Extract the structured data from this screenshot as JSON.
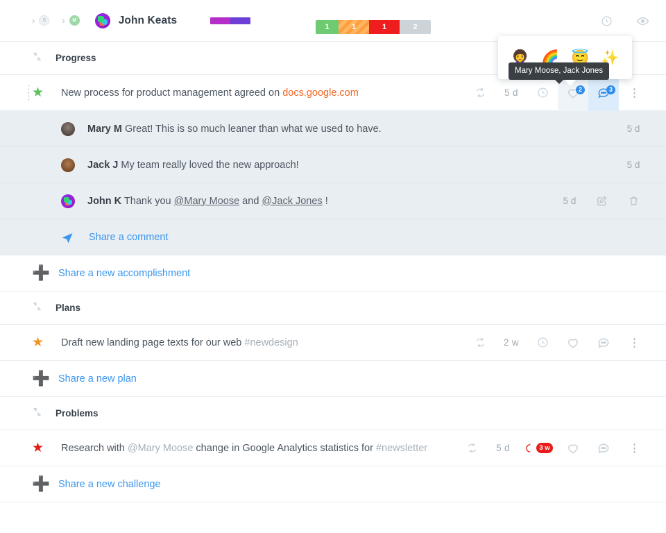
{
  "header": {
    "breadcrumbs": [
      {
        "sep": "›",
        "label": "S",
        "name": "breadcrumb-company"
      },
      {
        "sep": "›",
        "label": "M",
        "name": "breadcrumb-team"
      }
    ],
    "user_name": "John Keats",
    "avatar_name": "john-keats-avatar",
    "progress_chip_colors": [
      "#b42fc9",
      "#6d3fd4"
    ],
    "status_segments": [
      {
        "value": "1",
        "kind": "green"
      },
      {
        "value": "1",
        "kind": "orange"
      },
      {
        "value": "1",
        "kind": "red"
      },
      {
        "value": "2",
        "kind": "gray"
      }
    ],
    "icons": [
      {
        "name": "history-clock-icon"
      },
      {
        "name": "eye-visibility-icon"
      }
    ]
  },
  "popover": {
    "emojis": [
      "👩‍🦱",
      "🌈",
      "😇",
      "✨"
    ],
    "emoji_names": [
      "emoji-person",
      "emoji-rainbow",
      "emoji-angel",
      "emoji-sparkles"
    ],
    "tooltip_text": "Mary Moose, Jack Jones"
  },
  "sections": [
    {
      "title": "Progress",
      "collapse_icon": "collapse-arrows-icon",
      "add_label": "Share a new accomplishment",
      "add_name": "share-new-accomplishment-button",
      "tasks": [
        {
          "star_color": "green",
          "text_parts": [
            {
              "t": "New process for product management agreed on ",
              "style": "plain"
            },
            {
              "t": "docs.google.com",
              "style": "link-orange"
            }
          ],
          "repeat_icon": "repeat-task-icon",
          "time": "5 d",
          "clock_icon": "due-clock-icon",
          "like_count": "2",
          "comment_count": "3",
          "like_active": true,
          "comment_active": true
        }
      ],
      "comments": [
        {
          "avatar": "mary",
          "author": "Mary M",
          "parts": [
            {
              "t": " Great! This is so much leaner than what we used to have.",
              "style": "plain"
            }
          ],
          "time": "5 d",
          "editable": false
        },
        {
          "avatar": "jack",
          "author": "Jack J",
          "parts": [
            {
              "t": " My team really loved the new approach!",
              "style": "plain"
            }
          ],
          "time": "5 d",
          "editable": false
        },
        {
          "avatar": "john",
          "author": "John K",
          "parts": [
            {
              "t": " Thank you ",
              "style": "plain"
            },
            {
              "t": "@Mary Moose",
              "style": "mention"
            },
            {
              "t": " and ",
              "style": "plain"
            },
            {
              "t": "@Jack Jones",
              "style": "mention"
            },
            {
              "t": " !",
              "style": "plain"
            }
          ],
          "time": "5 d",
          "editable": true
        }
      ],
      "comment_add_label": "Share a comment",
      "comment_add_name": "share-a-comment-button"
    },
    {
      "title": "Plans",
      "collapse_icon": "collapse-arrows-icon",
      "add_label": "Share a new plan",
      "add_name": "share-new-plan-button",
      "tasks": [
        {
          "star_color": "orange",
          "text_parts": [
            {
              "t": "Draft new landing page texts for our web ",
              "style": "plain"
            },
            {
              "t": "#newdesign",
              "style": "tag"
            }
          ],
          "repeat_icon": "repeat-task-icon",
          "time": "2 w",
          "clock_icon": "due-clock-icon",
          "like_count": "",
          "comment_count": "",
          "like_active": false,
          "comment_active": false
        }
      ],
      "comments": [],
      "comment_add_label": "",
      "comment_add_name": ""
    },
    {
      "title": "Problems",
      "collapse_icon": "collapse-arrows-icon",
      "add_label": "Share a new challenge",
      "add_name": "share-new-challenge-button",
      "tasks": [
        {
          "star_color": "red",
          "text_parts": [
            {
              "t": "Research with ",
              "style": "plain"
            },
            {
              "t": "@Mary Moose",
              "style": "tag"
            },
            {
              "t": " change in Google Analytics statistics for ",
              "style": "plain"
            },
            {
              "t": "#newsletter",
              "style": "tag"
            }
          ],
          "repeat_icon": "repeat-task-icon",
          "time": "5 d",
          "overdue_badge": "3 w",
          "like_count": "",
          "comment_count": "",
          "like_active": false,
          "comment_active": false
        }
      ],
      "comments": [],
      "comment_add_label": "",
      "comment_add_name": ""
    }
  ]
}
